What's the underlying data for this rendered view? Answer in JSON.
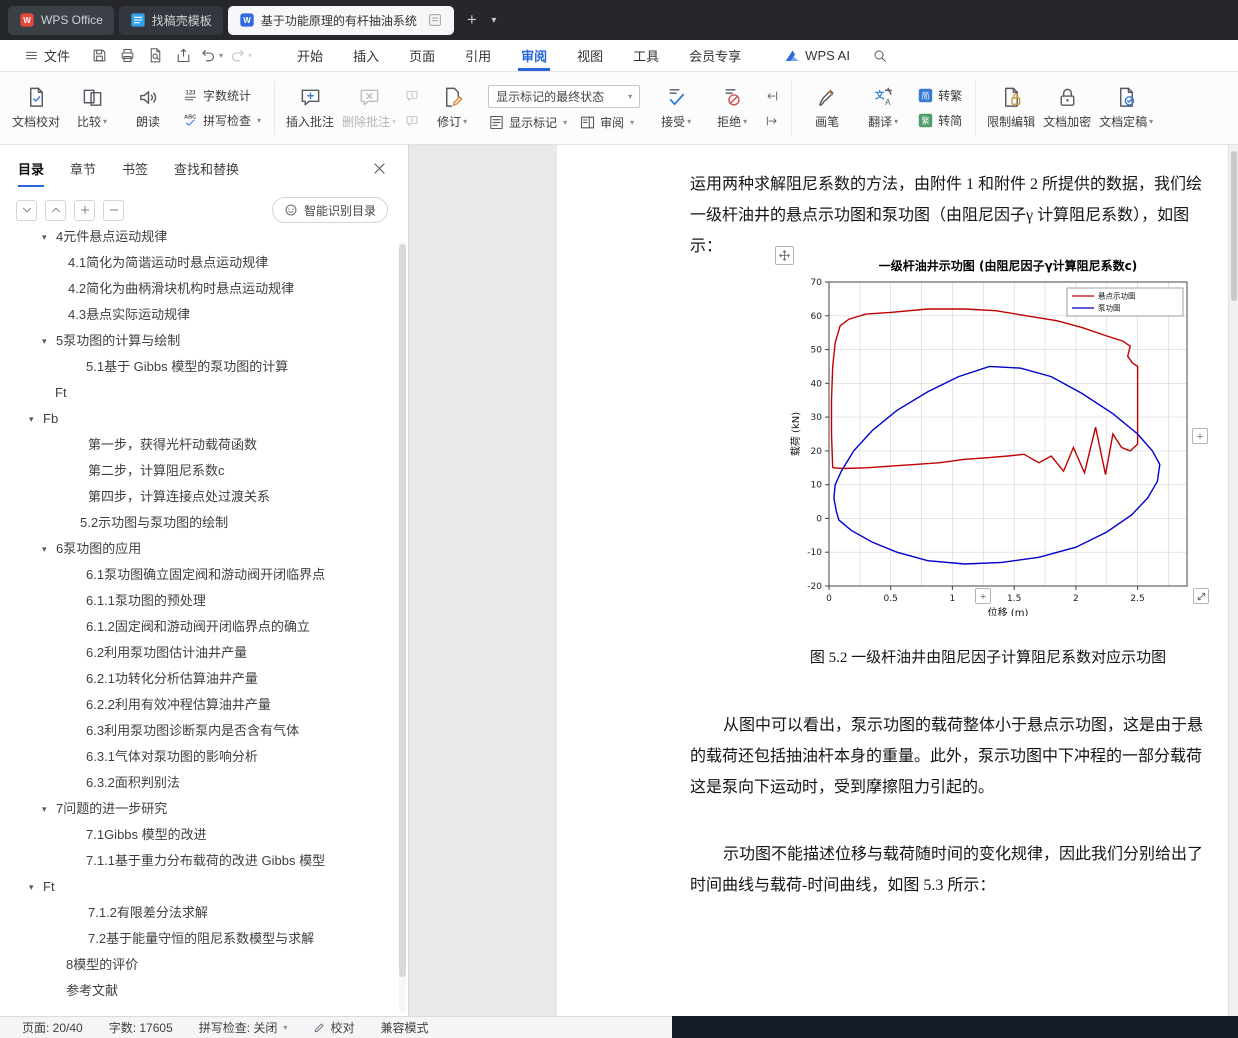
{
  "titlebar": {
    "tabs": [
      {
        "id": "wps-home",
        "label": "WPS Office",
        "icon": "wps-logo",
        "active": false
      },
      {
        "id": "doc-template",
        "label": "找稿壳模板",
        "icon": "template-icon",
        "active": false
      },
      {
        "id": "doc-current",
        "label": "基于功能原理的有杆抽油系统",
        "icon": "wdoc-icon",
        "active": true
      }
    ],
    "new_tab_label": "+"
  },
  "menubar": {
    "file_label": "文件",
    "quick_icons": [
      {
        "id": "save",
        "icon": "save"
      },
      {
        "id": "print",
        "icon": "print"
      },
      {
        "id": "print-preview",
        "icon": "preview"
      },
      {
        "id": "export-pdf",
        "icon": "export"
      },
      {
        "id": "undo",
        "icon": "undo",
        "dropdown": true
      },
      {
        "id": "redo",
        "icon": "redo",
        "dropdown": true,
        "disabled": true
      }
    ],
    "tabs": [
      {
        "id": "home",
        "label": "开始"
      },
      {
        "id": "insert",
        "label": "插入"
      },
      {
        "id": "page",
        "label": "页面"
      },
      {
        "id": "reference",
        "label": "引用"
      },
      {
        "id": "review",
        "label": "审阅",
        "active": true
      },
      {
        "id": "view",
        "label": "视图"
      },
      {
        "id": "tools",
        "label": "工具"
      },
      {
        "id": "member",
        "label": "会员专享"
      }
    ],
    "ai_label": "WPS AI"
  },
  "ribbon": {
    "groups": [
      {
        "items": [
          {
            "type": "big",
            "id": "doc-proofread",
            "label": "文档校对",
            "icon": "doc-check"
          },
          {
            "type": "big",
            "id": "compare",
            "label": "比较",
            "icon": "compare",
            "dropdown": true
          },
          {
            "type": "big",
            "id": "read-aloud",
            "label": "朗读",
            "icon": "speaker"
          },
          {
            "type": "stack",
            "rows": [
              {
                "id": "word-count",
                "label": "字数统计",
                "icon": "count123"
              },
              {
                "id": "spell-check",
                "label": "拼写检查",
                "icon": "abc",
                "dropdown": true
              }
            ]
          }
        ]
      },
      {
        "items": [
          {
            "type": "big",
            "id": "insert-comment",
            "label": "插入批注",
            "icon": "comment-plus"
          },
          {
            "type": "big",
            "id": "delete-comment",
            "label": "删除批注",
            "icon": "comment-x",
            "dropdown": true,
            "disabled": true
          },
          {
            "type": "mini",
            "rows": [
              {
                "id": "prev-comment",
                "icon": "comment-prev",
                "disabled": true
              },
              {
                "id": "next-comment",
                "icon": "comment-next",
                "disabled": true
              }
            ]
          },
          {
            "type": "big",
            "id": "track-changes",
            "label": "修订",
            "icon": "revise",
            "dropdown": true
          },
          {
            "type": "panel",
            "select": {
              "id": "markup-state",
              "label": "显示标记的最终状态"
            },
            "buttons": [
              {
                "id": "show-markup",
                "label": "显示标记",
                "icon": "show-mark",
                "dropdown": true
              },
              {
                "id": "review-pane",
                "label": "审阅",
                "icon": "review-pane",
                "dropdown": true
              }
            ]
          },
          {
            "type": "big",
            "id": "accept",
            "label": "接受",
            "icon": "accept",
            "dropdown": true
          },
          {
            "type": "big",
            "id": "reject",
            "label": "拒绝",
            "icon": "reject",
            "dropdown": true
          },
          {
            "type": "mini",
            "rows": [
              {
                "id": "prev-revision",
                "icon": "rev-prev"
              },
              {
                "id": "next-revision",
                "icon": "rev-next"
              }
            ]
          }
        ]
      },
      {
        "items": [
          {
            "type": "big",
            "id": "ink",
            "label": "画笔",
            "icon": "pen"
          },
          {
            "type": "big",
            "id": "translate",
            "label": "翻译",
            "icon": "translate",
            "dropdown": true
          },
          {
            "type": "stack",
            "rows": [
              {
                "id": "to-traditional",
                "label": "转繁",
                "icon": "jian"
              },
              {
                "id": "to-simplified",
                "label": "转简",
                "icon": "fan"
              }
            ]
          }
        ]
      },
      {
        "items": [
          {
            "type": "big",
            "id": "restrict-edit",
            "label": "限制编辑",
            "icon": "restrict"
          },
          {
            "type": "big",
            "id": "encrypt",
            "label": "文档加密",
            "icon": "encrypt"
          },
          {
            "type": "big",
            "id": "finalize",
            "label": "文档定稿",
            "icon": "finalize",
            "dropdown": true
          }
        ]
      }
    ]
  },
  "sidebar": {
    "tabs": [
      {
        "id": "toc",
        "label": "目录",
        "active": true
      },
      {
        "id": "chapter",
        "label": "章节"
      },
      {
        "id": "bookmark",
        "label": "书签"
      },
      {
        "id": "find-replace",
        "label": "查找和替换"
      }
    ],
    "controls": [
      {
        "id": "collapse",
        "icon": "chevron-down"
      },
      {
        "id": "expand",
        "icon": "chevron-up"
      },
      {
        "id": "expand-all",
        "icon": "plus"
      },
      {
        "id": "collapse-all",
        "icon": "minus"
      }
    ],
    "smart_button": "智能识别目录",
    "toc": [
      {
        "label": "4元件悬点运动规律",
        "indent": 56,
        "arrow": true
      },
      {
        "label": "4.1简化为简谐运动时悬点运动规律",
        "indent": 68
      },
      {
        "label": "4.2简化为曲柄滑块机构时悬点运动规律",
        "indent": 68
      },
      {
        "label": "4.3悬点实际运动规律",
        "indent": 68
      },
      {
        "label": "5泵功图的计算与绘制",
        "indent": 56,
        "arrow": true
      },
      {
        "label": "5.1基于 Gibbs 模型的泵功图的计算",
        "indent": 86
      },
      {
        "label": "Ft",
        "indent": 55
      },
      {
        "label": "Fb",
        "indent": 43,
        "arrow": true
      },
      {
        "label": "第一步，获得光杆动载荷函数",
        "indent": 88
      },
      {
        "label": "第二步，计算阻尼系数c",
        "indent": 88
      },
      {
        "label": "第四步，计算连接点处过渡关系",
        "indent": 88
      },
      {
        "label": "5.2示功图与泵功图的绘制",
        "indent": 80
      },
      {
        "label": "6泵功图的应用",
        "indent": 56,
        "arrow": true
      },
      {
        "label": "6.1泵功图确立固定阀和游动阀开闭临界点",
        "indent": 86
      },
      {
        "label": "6.1.1泵功图的预处理",
        "indent": 86
      },
      {
        "label": "6.1.2固定阀和游动阀开闭临界点的确立",
        "indent": 86
      },
      {
        "label": "6.2利用泵功图估计油井产量",
        "indent": 86
      },
      {
        "label": "6.2.1功转化分析估算油井产量",
        "indent": 86
      },
      {
        "label": "6.2.2利用有效冲程估算油井产量",
        "indent": 86
      },
      {
        "label": "6.3利用泵功图诊断泵内是否含有气体",
        "indent": 86
      },
      {
        "label": "6.3.1气体对泵功图的影响分析",
        "indent": 86
      },
      {
        "label": "6.3.2面积判别法",
        "indent": 86
      },
      {
        "label": "7问题的进一步研究",
        "indent": 56,
        "arrow": true
      },
      {
        "label": "7.1Gibbs 模型的改进",
        "indent": 86
      },
      {
        "label": "7.1.1基于重力分布载荷的改进 Gibbs 模型",
        "indent": 86
      },
      {
        "label": "Ft",
        "indent": 43,
        "arrow": true
      },
      {
        "label": "7.1.2有限差分法求解",
        "indent": 88
      },
      {
        "label": "7.2基于能量守恒的阻尼系数模型与求解",
        "indent": 88
      },
      {
        "label": "8模型的评价",
        "indent": 66
      },
      {
        "label": "参考文献",
        "indent": 66
      }
    ]
  },
  "document": {
    "lines_before_chart": [
      "运用两种求解阻尼系数的方法，由附件 1 和附件 2 所提供的数据，我们绘",
      "一级杆油井的悬点示功图和泵功图（由阻尼因子γ 计算阻尼系数），如图",
      "示："
    ],
    "caption": "图 5.2 一级杆油井由阻尼因子计算阻尼系数对应示功图",
    "paragraphs_after": [
      {
        "first_indent": true,
        "lines": [
          "从图中可以看出，泵示功图的载荷整体小于悬点示功图，这是由于悬",
          "的载荷还包括抽油杆本身的重量。此外，泵示功图中下冲程的一部分载荷",
          "这是泵向下运动时，受到摩擦阻力引起的。"
        ]
      },
      {
        "first_indent": true,
        "lines": [
          "示功图不能描述位移与载荷随时间的变化规律，因此我们分别给出了",
          "时间曲线与载荷-时间曲线，如图 5.3 所示："
        ]
      }
    ]
  },
  "chart_overlay": {
    "plus": "+"
  },
  "chart_data": {
    "type": "line",
    "title": "一级杆油井示功图 (由阻尼因子γ计算阻尼系数c)",
    "xlabel": "位移 (m)",
    "ylabel": "载荷 (kN)",
    "xlim": [
      0,
      2.9
    ],
    "ylim": [
      -20,
      70
    ],
    "xticks": [
      0,
      0.5,
      1,
      1.5,
      2,
      2.5
    ],
    "yticks": [
      -20,
      -10,
      0,
      10,
      20,
      30,
      40,
      50,
      60,
      70
    ],
    "grid": true,
    "x_grid_step": 0.25,
    "y_grid_step": 10,
    "legend_position": "top-right",
    "series": [
      {
        "name": "悬点示功图",
        "color": "#c00000",
        "points": [
          [
            0.03,
            15
          ],
          [
            0.02,
            25
          ],
          [
            0.02,
            35
          ],
          [
            0.03,
            45
          ],
          [
            0.05,
            52
          ],
          [
            0.09,
            57
          ],
          [
            0.16,
            59
          ],
          [
            0.3,
            60.5
          ],
          [
            0.5,
            61
          ],
          [
            0.8,
            62
          ],
          [
            1.1,
            62
          ],
          [
            1.35,
            61.5
          ],
          [
            1.6,
            60
          ],
          [
            1.85,
            58.5
          ],
          [
            2.05,
            56.5
          ],
          [
            2.25,
            54
          ],
          [
            2.38,
            52.5
          ],
          [
            2.44,
            51
          ],
          [
            2.42,
            48
          ],
          [
            2.46,
            46
          ],
          [
            2.5,
            45
          ],
          [
            2.5,
            36
          ],
          [
            2.5,
            28
          ],
          [
            2.5,
            22
          ],
          [
            2.44,
            20
          ],
          [
            2.37,
            21
          ],
          [
            2.3,
            25
          ],
          [
            2.24,
            13
          ],
          [
            2.16,
            27
          ],
          [
            2.07,
            13.5
          ],
          [
            1.98,
            21
          ],
          [
            1.9,
            14
          ],
          [
            1.8,
            18.5
          ],
          [
            1.7,
            16.5
          ],
          [
            1.58,
            19
          ],
          [
            1.45,
            18.5
          ],
          [
            1.3,
            18
          ],
          [
            1.1,
            17.5
          ],
          [
            0.9,
            16.5
          ],
          [
            0.7,
            16
          ],
          [
            0.5,
            15.5
          ],
          [
            0.3,
            15
          ],
          [
            0.12,
            14.8
          ],
          [
            0.03,
            15
          ]
        ]
      },
      {
        "name": "泵功图",
        "color": "#0000cc",
        "points": [
          [
            0.06,
            2
          ],
          [
            0.04,
            6
          ],
          [
            0.05,
            10
          ],
          [
            0.1,
            14
          ],
          [
            0.2,
            20
          ],
          [
            0.35,
            26
          ],
          [
            0.55,
            32
          ],
          [
            0.8,
            37.5
          ],
          [
            1.05,
            42
          ],
          [
            1.3,
            45
          ],
          [
            1.55,
            44.5
          ],
          [
            1.8,
            42
          ],
          [
            2.05,
            37
          ],
          [
            2.3,
            31
          ],
          [
            2.5,
            25
          ],
          [
            2.62,
            20
          ],
          [
            2.68,
            16
          ],
          [
            2.66,
            11
          ],
          [
            2.58,
            6
          ],
          [
            2.45,
            1
          ],
          [
            2.25,
            -4
          ],
          [
            2,
            -8.5
          ],
          [
            1.7,
            -11.5
          ],
          [
            1.4,
            -13
          ],
          [
            1.1,
            -13.5
          ],
          [
            0.8,
            -12.5
          ],
          [
            0.55,
            -10
          ],
          [
            0.35,
            -7
          ],
          [
            0.18,
            -3.5
          ],
          [
            0.08,
            -0.5
          ],
          [
            0.06,
            2
          ]
        ]
      }
    ]
  },
  "statusbar": {
    "items": [
      {
        "id": "page-indicator",
        "label": "页面: 20/40"
      },
      {
        "id": "word-count",
        "label": "字数: 17605"
      },
      {
        "id": "spell-check",
        "label": "拼写检查: 关闭",
        "dropdown": true
      },
      {
        "id": "proofread",
        "label": "校对",
        "icon": "pencil"
      },
      {
        "id": "compat-mode",
        "label": "兼容模式"
      }
    ]
  }
}
